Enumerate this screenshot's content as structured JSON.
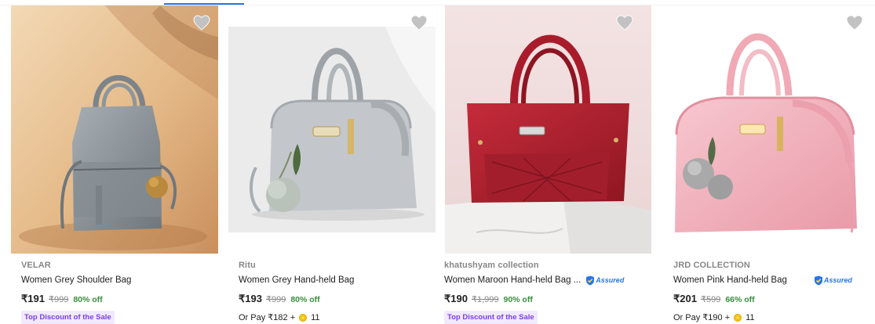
{
  "products": [
    {
      "brand": "VELAR",
      "title": "Women Grey Shoulder Bag",
      "assured": "",
      "price": "₹191",
      "mrp": "₹999",
      "discount": "80% off",
      "badge": "Top Discount of the Sale",
      "or_pay": "",
      "coins": ""
    },
    {
      "brand": "Ritu",
      "title": "Women Grey Hand-held Bag",
      "assured": "",
      "price": "₹193",
      "mrp": "₹999",
      "discount": "80% off",
      "badge": "",
      "or_pay": "Or Pay ₹182 +",
      "coins": "11"
    },
    {
      "brand": "khatushyam collection",
      "title": "Women Maroon Hand-held Bag ...",
      "assured": "Assured",
      "price": "₹190",
      "mrp": "₹1,999",
      "discount": "90% off",
      "badge": "Top Discount of the Sale",
      "or_pay": "",
      "coins": ""
    },
    {
      "brand": "JRD COLLECTION",
      "title": "Women Pink Hand-held Bag",
      "assured": "Assured",
      "price": "₹201",
      "mrp": "₹599",
      "discount": "66% off",
      "badge": "",
      "or_pay": "Or Pay ₹190 +",
      "coins": "11"
    }
  ],
  "icons": {
    "wishlist": "heart-icon",
    "assured": "assured-shield-icon",
    "coin": "supercoin-icon"
  },
  "colors": {
    "accent": "#2874f0",
    "discount": "#388e3c",
    "badge_text": "#7b3fe4",
    "badge_bg": "#f1eafe",
    "muted": "#878787"
  }
}
